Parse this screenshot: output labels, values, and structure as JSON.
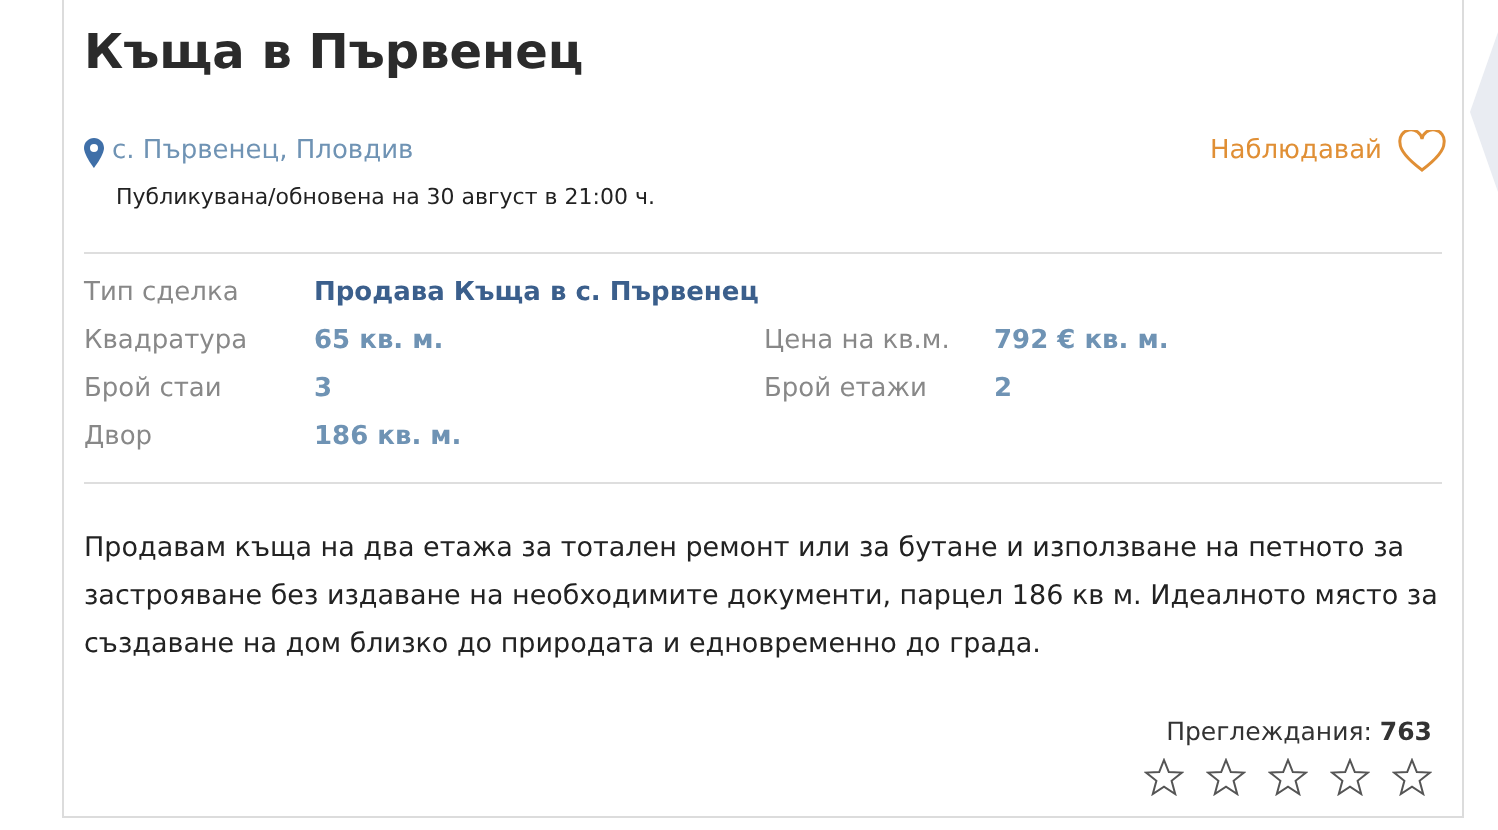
{
  "title": "Къща в Първенец",
  "location": "с. Първенец, Пловдив",
  "watch": {
    "label": "Наблюдавай",
    "selected": false
  },
  "published": "Публикувана/обновена на 30 август в 21:00 ч.",
  "details": [
    {
      "label": "Тип сделка",
      "value": "Продава Къща в с. Първенец",
      "kind": "deal"
    },
    {
      "label": "Квадратура",
      "value": "65 кв. м.",
      "kind": "plain"
    },
    {
      "label": "Цена на кв.м.",
      "value": "792 € кв. м.",
      "kind": "plain"
    },
    {
      "label": "Брой стаи",
      "value": "3",
      "kind": "plain"
    },
    {
      "label": "Брой етажи",
      "value": "2",
      "kind": "plain"
    },
    {
      "label": "Двор",
      "value": "186 кв. м.",
      "kind": "plain"
    }
  ],
  "description": "Продавам къща на два етажа за тотален ремонт или за бутане и използване на петното за застрояване без издаване на необходимите документи, парцел 186 кв м. Идеалното място за създаване на дом близко до природата и едновременно до града.",
  "views": {
    "label": "Преглеждания:",
    "count": "763"
  },
  "rating": {
    "stars": 0
  }
}
